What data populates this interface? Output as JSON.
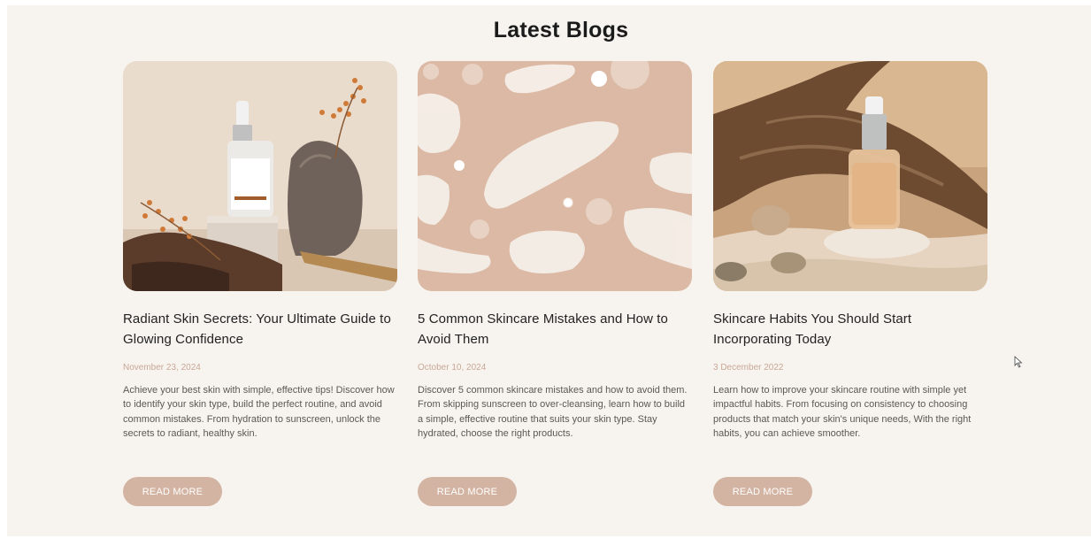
{
  "section": {
    "title": "Latest Blogs"
  },
  "posts": [
    {
      "title": "Radiant Skin Secrets: Your Ultimate Guide to Glowing Confidence",
      "date": "November 23, 2024",
      "description": "Achieve your best skin with simple, effective tips! Discover how to identify your skin type, build the perfect routine, and avoid common mistakes. From hydration to sunscreen, unlock the secrets to radiant, healthy skin.",
      "button": "READ MORE"
    },
    {
      "title": "5 Common Skincare Mistakes and How to Avoid Them",
      "date": "October 10, 2024",
      "description": "Discover 5 common skincare mistakes and how to avoid them. From skipping sunscreen to over-cleansing, learn how to build a simple, effective routine that suits your skin type. Stay hydrated, choose the right products.",
      "button": "READ MORE"
    },
    {
      "title": "Skincare Habits You Should Start Incorporating Today",
      "date": "3 December 2022",
      "description": "Learn how to improve your skincare routine with simple yet impactful habits. From focusing on consistency to choosing products that match your skin's unique needs, With the right habits, you can achieve smoother.",
      "button": "READ MORE"
    }
  ],
  "colors": {
    "background": "#f7f4ef",
    "accent": "#d3b3a2",
    "date": "#c9a796"
  },
  "icons": {
    "cursor": "mouse-pointer-icon"
  }
}
